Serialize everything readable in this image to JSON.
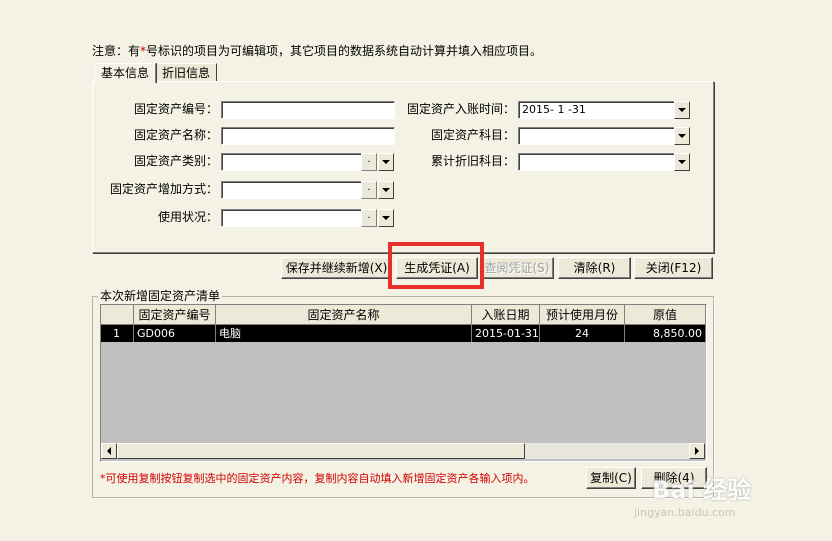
{
  "notice": {
    "prefix": "注意：有",
    "star": "*",
    "suffix": "号标识的项目为可编辑项，其它项目的数据系统自动计算并填入相应项目。"
  },
  "tabs": [
    {
      "label": "基本信息",
      "active": true
    },
    {
      "label": "折旧信息",
      "active": false
    }
  ],
  "form": {
    "asset_code": {
      "label": "固定资产编号：",
      "value": ""
    },
    "asset_name": {
      "label": "固定资产名称：",
      "value": ""
    },
    "asset_category": {
      "label": "固定资产类别：",
      "value": ""
    },
    "add_method": {
      "label": "固定资产增加方式：",
      "value": ""
    },
    "usage_status": {
      "label": "使用状况：",
      "value": ""
    },
    "entry_date": {
      "label": "固定资产入账时间：",
      "value": "2015- 1 -31"
    },
    "asset_account": {
      "label": "固定资产科目：",
      "value": ""
    },
    "depr_account": {
      "label": "累计折旧科目：",
      "value": ""
    }
  },
  "buttons": {
    "save_continue": "保存并继续新增(X)",
    "generate_voucher": "生成凭证(A)",
    "review_voucher": "查阅凭证(S)",
    "clear": "清除(R)",
    "close": "关闭(F12)",
    "copy": "复制(C)",
    "delete": "删除(4)"
  },
  "list": {
    "title": "本次新增固定资产清单",
    "columns": [
      "",
      "固定资产编号",
      "固定资产名称",
      "入账日期",
      "预计使用月份",
      "原值"
    ],
    "rows": [
      {
        "idx": "1",
        "code": "GD006",
        "name": "电脑",
        "date": "2015-01-31",
        "months": "24",
        "value": "8,850.00"
      }
    ]
  },
  "hint": "*可使用复制按钮复制选中的固定资产内容，复制内容自动填入新增固定资产各输入项内。",
  "watermark": {
    "brand": "Bai 经验",
    "url": "jingyan.baidu.com"
  },
  "colors": {
    "highlight": "#e8302a",
    "hint": "#d00000",
    "background": "#f4f2e4"
  }
}
